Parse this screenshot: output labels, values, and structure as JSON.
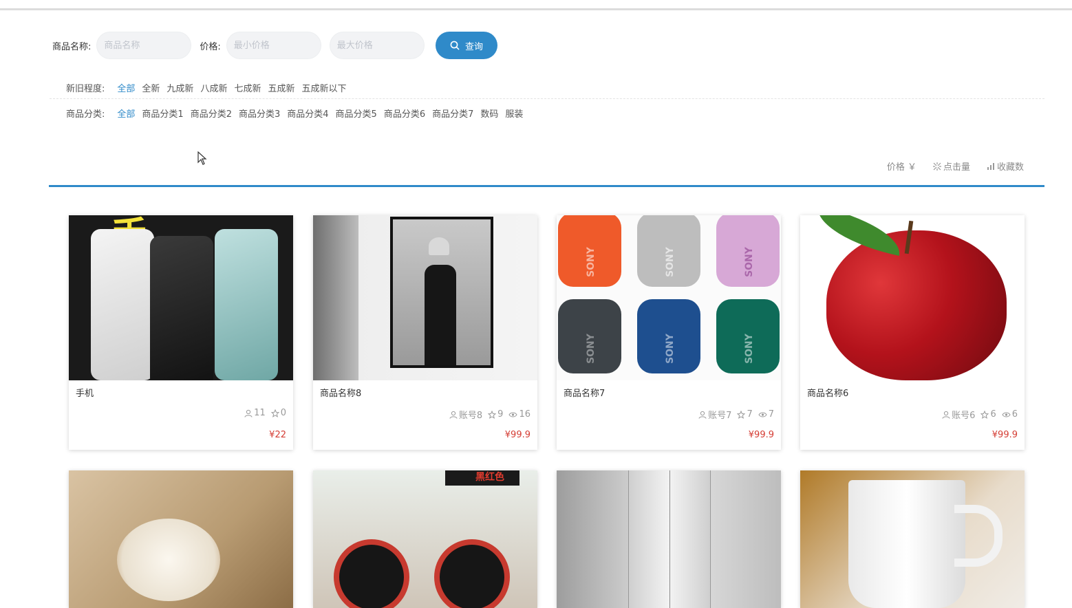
{
  "search": {
    "name_label": "商品名称:",
    "name_placeholder": "商品名称",
    "price_label": "价格:",
    "min_placeholder": "最小价格",
    "max_placeholder": "最大价格",
    "query_label": "查询"
  },
  "filters": {
    "condition": {
      "label": "新旧程度:",
      "options": [
        "全部",
        "全新",
        "九成新",
        "八成新",
        "七成新",
        "五成新",
        "五成新以下"
      ]
    },
    "category": {
      "label": "商品分类:",
      "options": [
        "全部",
        "商品分类1",
        "商品分类2",
        "商品分类3",
        "商品分类4",
        "商品分类5",
        "商品分类6",
        "商品分类7",
        "数码",
        "服装"
      ]
    }
  },
  "sort": {
    "price": "价格 ￥",
    "clicks": "点击量",
    "favorites": "收藏数"
  },
  "products": [
    {
      "name": "手机",
      "account": "11",
      "stars": "0",
      "views": "",
      "price": "¥22",
      "image_text": "手 机"
    },
    {
      "name": "商品名称8",
      "account": "账号8",
      "stars": "9",
      "views": "16",
      "price": "¥99.9"
    },
    {
      "name": "商品名称7",
      "account": "账号7",
      "stars": "7",
      "views": "7",
      "price": "¥99.9",
      "image_text": "SONY"
    },
    {
      "name": "商品名称6",
      "account": "账号6",
      "stars": "6",
      "views": "6",
      "price": "¥99.9"
    }
  ],
  "second_row_image_text": "黑红色",
  "colors": {
    "accent": "#2f8ac9",
    "price": "#d43c33"
  }
}
